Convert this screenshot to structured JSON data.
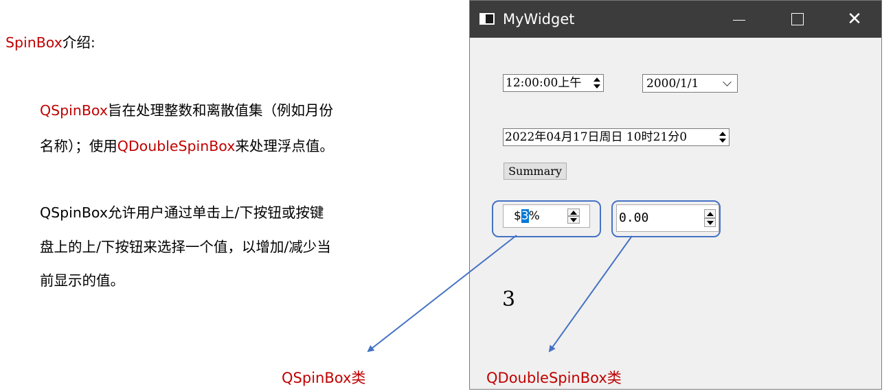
{
  "slide": {
    "heading_red": "SpinBox",
    "heading_rest": "介绍:",
    "para1_line1_red": "QSpinBox",
    "para1_line1_rest": "旨在处理整数和离散值集（例如月份",
    "para1_line2_a": "名称）；使用",
    "para1_line2_red": "QDoubleSpinBox",
    "para1_line2_b": "来处理浮点值。",
    "para2_line1": "QSpinBox允许用户通过单击上/下按钮或按键",
    "para2_line2": "盘上的上/下按钮来选择一个值，以增加/减少当",
    "para2_line3": "前显示的值。",
    "caption_qspinbox": "QSpinBox类",
    "caption_qdoublespinbox": "QDoubleSpinBox类",
    "text_color_red": "#c00000",
    "arrow_color": "#4472c4"
  },
  "window": {
    "title": "MyWidget",
    "titlebar_color": "#3c3c3c",
    "controls": {
      "minimize": "minimize-icon",
      "maximize": "maximize-icon",
      "close": "✕"
    },
    "time_edit": {
      "value": "12:00:00上午"
    },
    "date_combo": {
      "value": "2000/1/1"
    },
    "datetime_edit": {
      "value": "2022年04月17日周日 10时21分0"
    },
    "summary_button": {
      "label": "Summary"
    },
    "spinbox": {
      "prefix": "$",
      "value": "3",
      "suffix": "%"
    },
    "double_spinbox": {
      "value": "0.00"
    },
    "result_label": "3"
  }
}
